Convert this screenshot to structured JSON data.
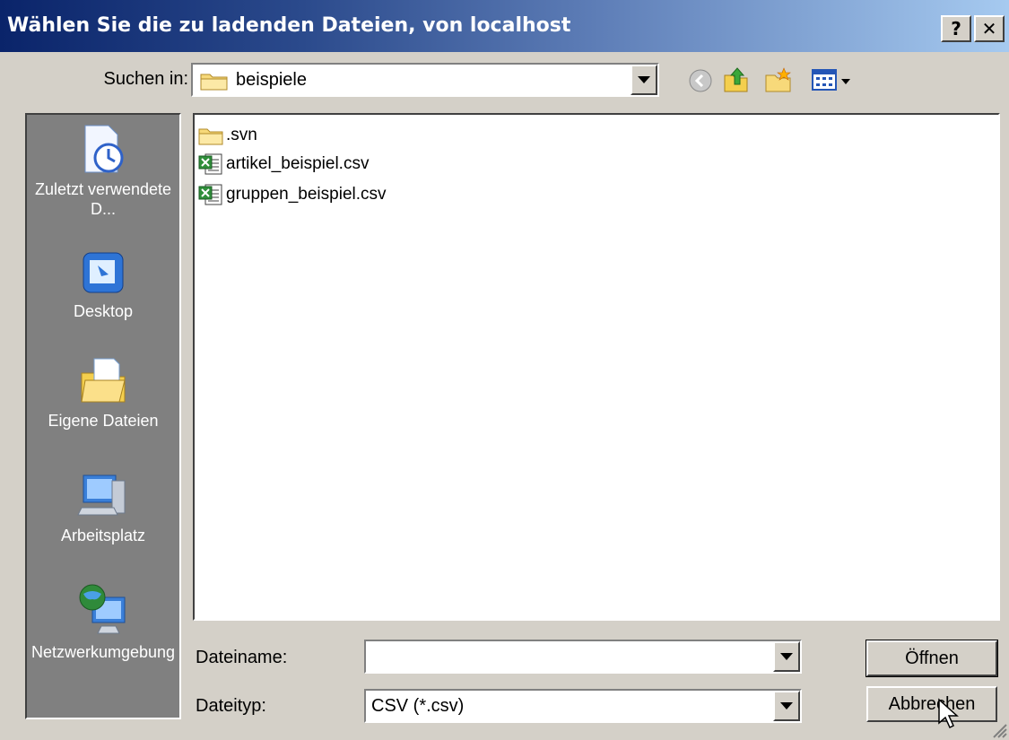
{
  "window": {
    "title": "Wählen Sie die zu ladenden Dateien, von localhost",
    "help_label": "?",
    "close_label": "✕"
  },
  "lookin": {
    "label": "Suchen in:",
    "value": "beispiele",
    "icons": [
      "back-icon",
      "up-folder-icon",
      "new-folder-icon",
      "view-menu-icon"
    ]
  },
  "places": [
    {
      "label": "Zuletzt verwendete D...",
      "icon": "recent-documents-icon"
    },
    {
      "label": "Desktop",
      "icon": "desktop-icon"
    },
    {
      "label": "Eigene Dateien",
      "icon": "my-documents-icon"
    },
    {
      "label": "Arbeitsplatz",
      "icon": "my-computer-icon"
    },
    {
      "label": "Netzwerkumgebung",
      "icon": "network-places-icon"
    }
  ],
  "files": [
    {
      "name": ".svn",
      "icon": "folder-icon"
    },
    {
      "name": "artikel_beispiel.csv",
      "icon": "csv-file-icon"
    },
    {
      "name": "gruppen_beispiel.csv",
      "icon": "csv-file-icon"
    }
  ],
  "filename": {
    "label": "Dateiname:",
    "value": ""
  },
  "filetype": {
    "label": "Dateityp:",
    "value": "CSV (*.csv)"
  },
  "buttons": {
    "open": "Öffnen",
    "cancel": "Abbrechen"
  },
  "colors": {
    "titlebar_start": "#0a246a",
    "titlebar_end": "#a6caf0",
    "dialog_bg": "#d4d0c8",
    "places_bg": "#808080"
  }
}
